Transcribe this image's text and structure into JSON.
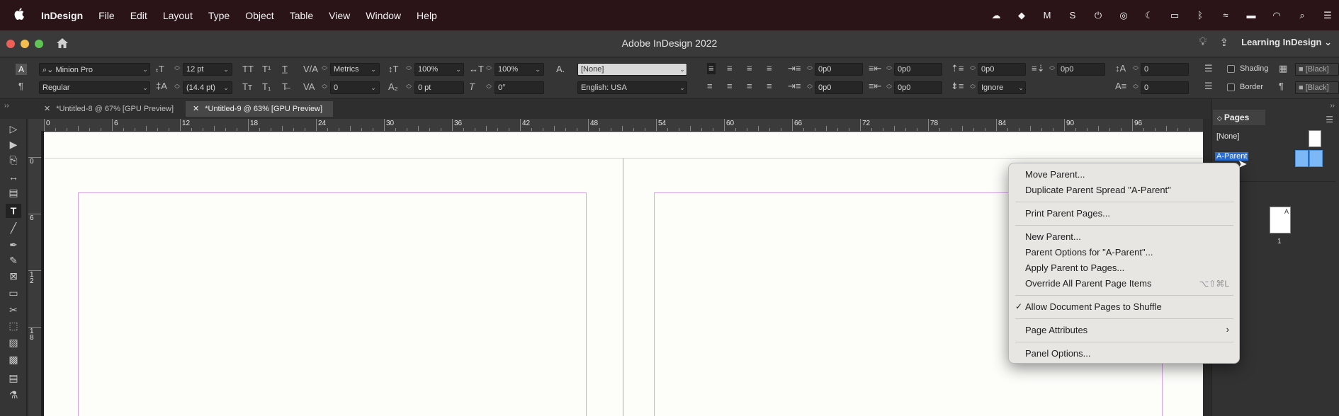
{
  "menubar": {
    "items": [
      "InDesign",
      "File",
      "Edit",
      "Layout",
      "Type",
      "Object",
      "Table",
      "View",
      "Window",
      "Help"
    ]
  },
  "titlebar": {
    "title": "Adobe InDesign 2022",
    "workspace": "Learning InDesign"
  },
  "control": {
    "font_family": "Minion Pro",
    "font_style": "Regular",
    "font_size": "12 pt",
    "leading": "(14.4 pt)",
    "kerning": "Metrics",
    "tracking": "0",
    "vscale": "100%",
    "hscale": "100%",
    "baseline": "0 pt",
    "skew": "0°",
    "char_style": "[None]",
    "language": "English: USA",
    "indent_left": "0p0",
    "indent_first": "0p0",
    "indent_right": "0p0",
    "indent_last": "0p0",
    "space_before": "0p0",
    "space_after": "0p0",
    "space_before2": "0p0",
    "grid_align": "Ignore",
    "drop_cap_lines": "0",
    "drop_cap_chars": "0",
    "shading_label": "Shading",
    "border_label": "Border",
    "shading_color": "[Black]",
    "border_color": "[Black]"
  },
  "tabs": [
    {
      "label": "*Untitled-8 @ 67% [GPU Preview]"
    },
    {
      "label": "*Untitled-9 @ 63% [GPU Preview]"
    }
  ],
  "ruler_h": [
    "0",
    "6",
    "12",
    "18",
    "24",
    "30",
    "36",
    "42",
    "48",
    "54",
    "60",
    "66",
    "72",
    "78",
    "84",
    "90",
    "96"
  ],
  "ruler_v": [
    "0",
    "6",
    "1\n2",
    "1\n8"
  ],
  "pages_panel": {
    "title": "Pages",
    "none_label": "[None]",
    "parent_label": "A-Parent",
    "thumb_letter": "A",
    "page_number": "1"
  },
  "context_menu": {
    "items": [
      {
        "label": "Move Parent..."
      },
      {
        "label": "Duplicate Parent Spread \"A-Parent\""
      },
      {
        "label": "Print Parent Pages..."
      },
      {
        "label": "New Parent..."
      },
      {
        "label": "Parent Options for \"A-Parent\"..."
      },
      {
        "label": "Apply Parent to Pages..."
      },
      {
        "label": "Override All Parent Page Items",
        "shortcut": "⌥⇧⌘L"
      },
      {
        "label": "Allow Document Pages to Shuffle",
        "checked": true
      },
      {
        "label": "Page Attributes"
      },
      {
        "label": "Panel Options..."
      }
    ]
  }
}
